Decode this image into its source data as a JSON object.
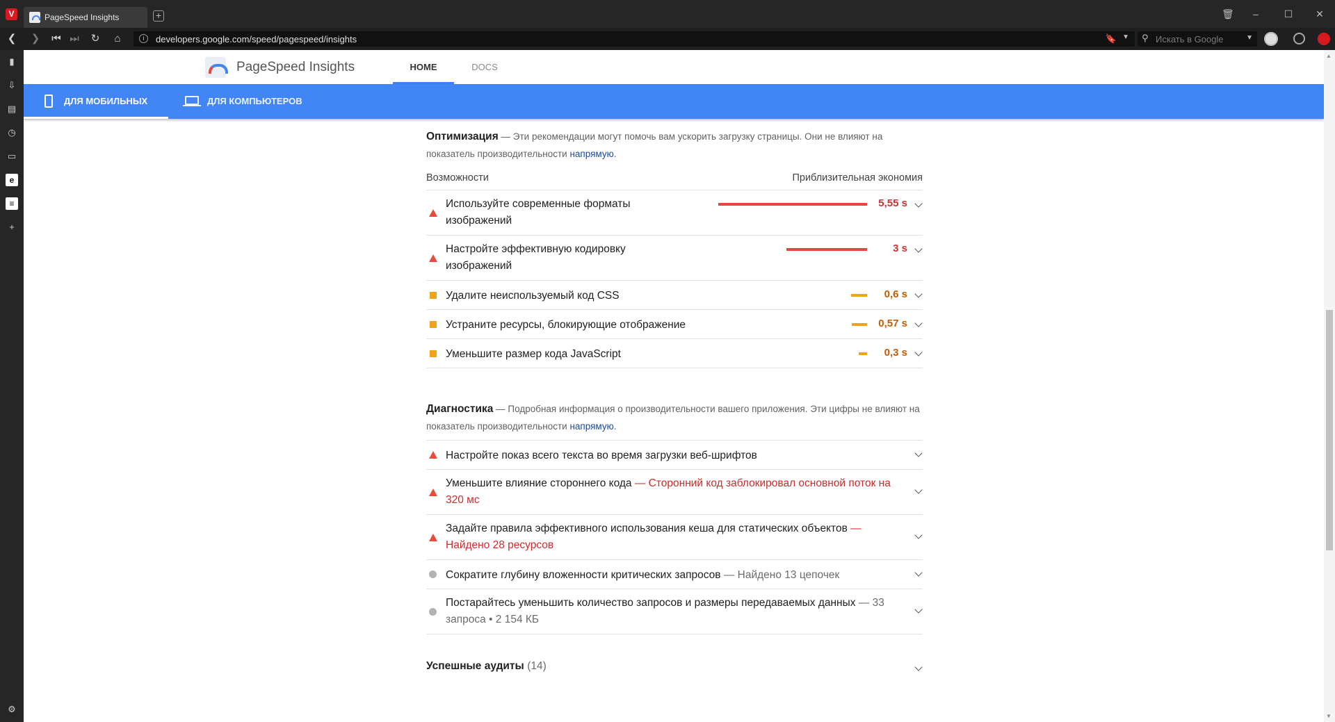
{
  "browser": {
    "tab_title": "PageSpeed Insights",
    "url": "developers.google.com/speed/pagespeed/insights",
    "search_placeholder": "Искать в Google"
  },
  "header": {
    "title": "PageSpeed Insights",
    "nav": [
      {
        "label": "HOME",
        "active": true
      },
      {
        "label": "DOCS",
        "active": false
      }
    ]
  },
  "device_tabs": [
    {
      "label": "ДЛЯ МОБИЛЬНЫХ",
      "active": true
    },
    {
      "label": "ДЛЯ КОМПЬЮТЕРОВ",
      "active": false
    }
  ],
  "optimization": {
    "title": "Оптимизация",
    "desc": "— Эти рекомендации могут помочь вам ускорить загрузку страницы. Они не влияют на показатель производительности",
    "link": "напрямую",
    "col_left": "Возможности",
    "col_right": "Приблизительная экономия",
    "items": [
      {
        "severity": "fail",
        "text": "Используйте современные форматы изображений",
        "value": "5,55 s",
        "savings_s": 5.55
      },
      {
        "severity": "fail",
        "text": "Настройте эффективную кодировку изображений",
        "value": "3 s",
        "savings_s": 3.0
      },
      {
        "severity": "average",
        "text": "Удалите неиспользуемый код CSS",
        "value": "0,6 s",
        "savings_s": 0.6
      },
      {
        "severity": "average",
        "text": "Устраните ресурсы, блокирующие отображение",
        "value": "0,57 s",
        "savings_s": 0.57
      },
      {
        "severity": "average",
        "text": "Уменьшите размер кода JavaScript",
        "value": "0,3 s",
        "savings_s": 0.3
      }
    ]
  },
  "diagnostics": {
    "title": "Диагностика",
    "desc": "— Подробная информация о производительности вашего приложения. Эти цифры не влияют на показатель производительности",
    "link": "напрямую",
    "items": [
      {
        "severity": "fail",
        "text": "Настройте показ всего текста во время загрузки веб-шрифтов",
        "detail": ""
      },
      {
        "severity": "fail",
        "text": "Уменьшите влияние стороннего кода",
        "detail": "— Сторонний код заблокировал основной поток на 320 мс"
      },
      {
        "severity": "fail",
        "text": "Задайте правила эффективного использования кеша для статических объектов",
        "detail": "— Найдено 28 ресурсов"
      },
      {
        "severity": "info",
        "text": "Сократите глубину вложенности критических запросов",
        "detail": "— Найдено 13 цепочек"
      },
      {
        "severity": "info",
        "text": "Постарайтесь уменьшить количество запросов и размеры передаваемых данных",
        "detail": "— 33 запроса • 2 154 КБ"
      }
    ]
  },
  "passed": {
    "title": "Успешные аудиты",
    "count": "(14)"
  },
  "colors": {
    "fail": "#eb4a3c",
    "average": "#f2a11b",
    "info": "#b3b3b3",
    "device_bar": "#4285f4",
    "link": "#1a4ba0"
  }
}
